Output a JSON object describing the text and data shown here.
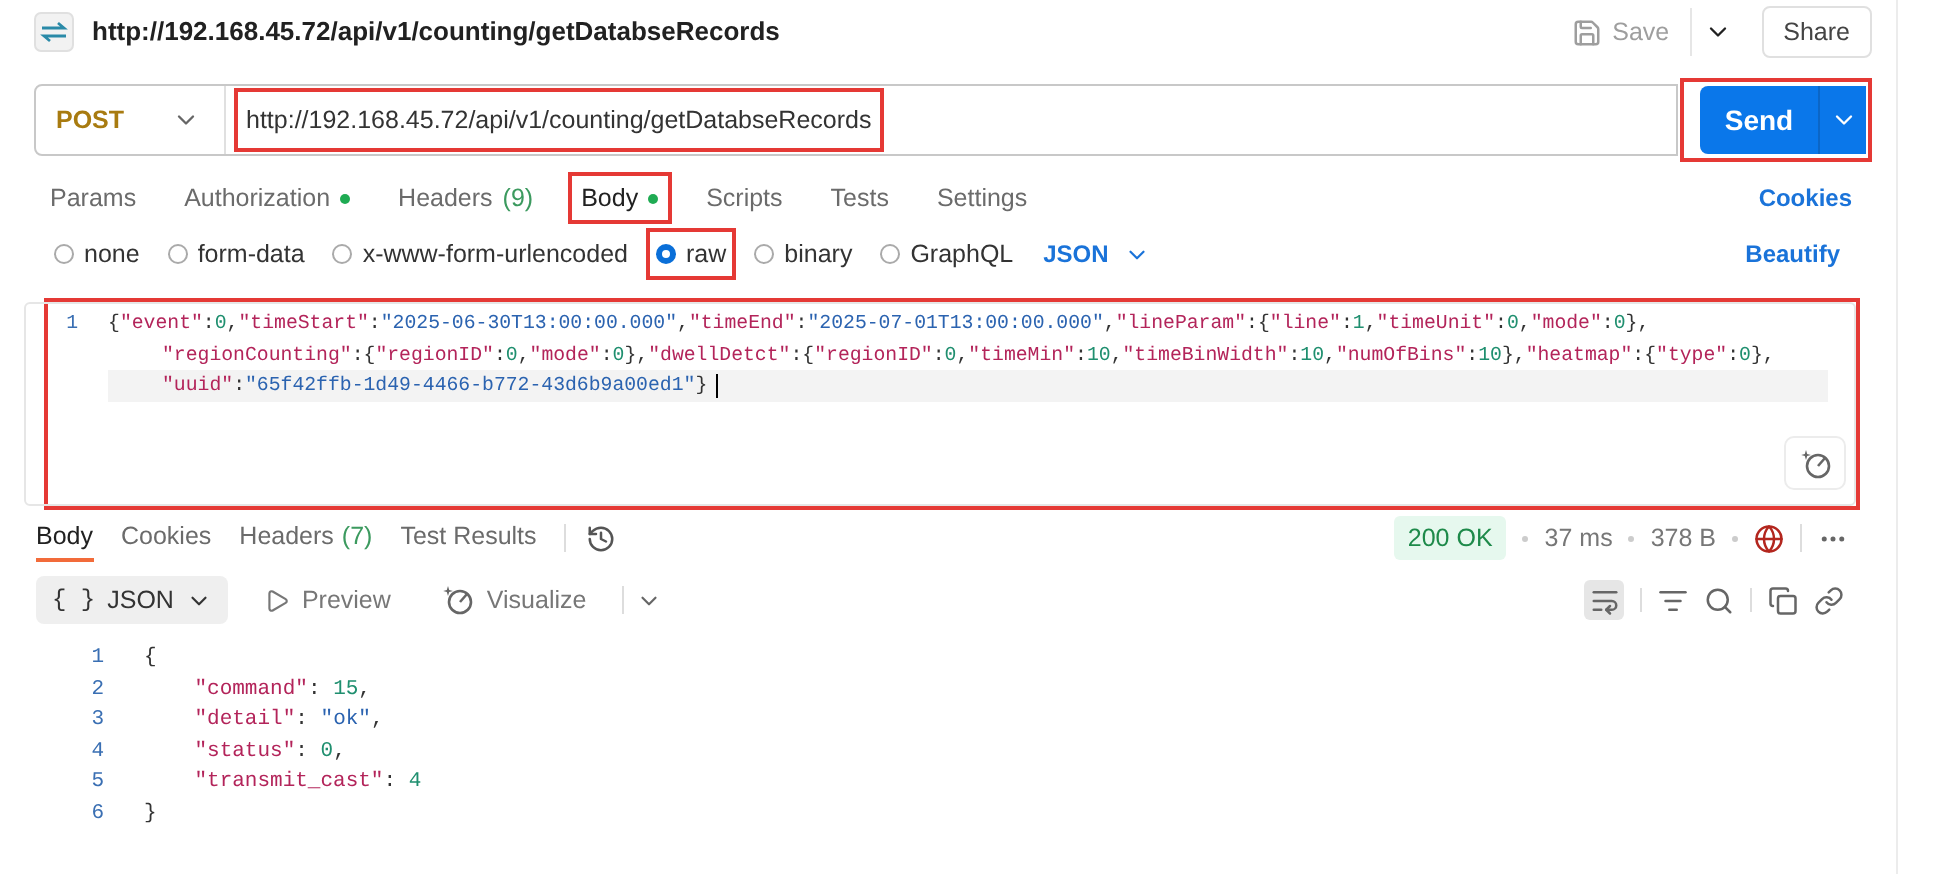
{
  "request": {
    "title": "http://192.168.45.72/api/v1/counting/getDatabseRecords",
    "save_label": "Save",
    "share_label": "Share",
    "method": "POST",
    "url": "http://192.168.45.72/api/v1/counting/getDatabseRecords",
    "url_highlighted": true,
    "send_label": "Send",
    "send_highlighted": true
  },
  "request_tabs": [
    {
      "label": "Params",
      "selected": false,
      "dot": false,
      "highlighted": false
    },
    {
      "label": "Authorization",
      "selected": false,
      "dot": true,
      "highlighted": false
    },
    {
      "label": "Headers",
      "count": "(9)",
      "selected": false,
      "dot": false,
      "highlighted": false
    },
    {
      "label": "Body",
      "selected": true,
      "dot": true,
      "highlighted": true
    },
    {
      "label": "Scripts",
      "selected": false,
      "dot": false,
      "highlighted": false
    },
    {
      "label": "Tests",
      "selected": false,
      "dot": false,
      "highlighted": false
    },
    {
      "label": "Settings",
      "selected": false,
      "dot": false,
      "highlighted": false
    }
  ],
  "cookies_link": "Cookies",
  "body_types": [
    {
      "label": "none",
      "selected": false,
      "highlighted": false
    },
    {
      "label": "form-data",
      "selected": false,
      "highlighted": false
    },
    {
      "label": "x-www-form-urlencoded",
      "selected": false,
      "highlighted": false
    },
    {
      "label": "raw",
      "selected": true,
      "highlighted": true
    },
    {
      "label": "binary",
      "selected": false,
      "highlighted": false
    },
    {
      "label": "GraphQL",
      "selected": false,
      "highlighted": false
    }
  ],
  "body_format": "JSON",
  "beautify_link": "Beautify",
  "request_body": {
    "highlighted": true,
    "line_number": "1",
    "rows": [
      {
        "text": "{\"event\":0,\"timeStart\":\"2025-06-30T13:00:00.000\",\"timeEnd\":\"2025-07-01T13:00:00.000\",\"lineParam\":{\"line\":1,\"timeUnit\":0,\"mode\":0},",
        "active": false
      },
      {
        "text": "\"regionCounting\":{\"regionID\":0,\"mode\":0},\"dwellDetct\":{\"regionID\":0,\"timeMin\":10,\"timeBinWidth\":10,\"numOfBins\":10},\"heatmap\":{\"type\":0},",
        "active": false
      },
      {
        "text": "\"uuid\":\"65f42ffb-1d49-4466-b772-43d6b9a00ed1\"}",
        "active": true
      }
    ]
  },
  "response_tabs": [
    {
      "label": "Body",
      "selected": true
    },
    {
      "label": "Cookies",
      "selected": false
    },
    {
      "label": "Headers",
      "count": "(7)",
      "selected": false
    },
    {
      "label": "Test Results",
      "selected": false
    }
  ],
  "status": "200 OK",
  "time": "37 ms",
  "size": "378 B",
  "view_modes": [
    {
      "label": "JSON",
      "kind": "format",
      "symbol": "{ }",
      "selected": true
    },
    {
      "label": "Preview",
      "kind": "preview",
      "selected": false
    },
    {
      "label": "Visualize",
      "kind": "visualize",
      "selected": false
    }
  ],
  "wrap_lines": true,
  "response_body": {
    "lines": [
      {
        "number": "1",
        "text": "{"
      },
      {
        "number": "2",
        "text": "    \"command\": 15,"
      },
      {
        "number": "3",
        "text": "    \"detail\": \"ok\","
      },
      {
        "number": "4",
        "text": "    \"status\": 0,"
      },
      {
        "number": "5",
        "text": "    \"transmit_cast\": 4"
      },
      {
        "number": "6",
        "text": "}"
      }
    ]
  }
}
